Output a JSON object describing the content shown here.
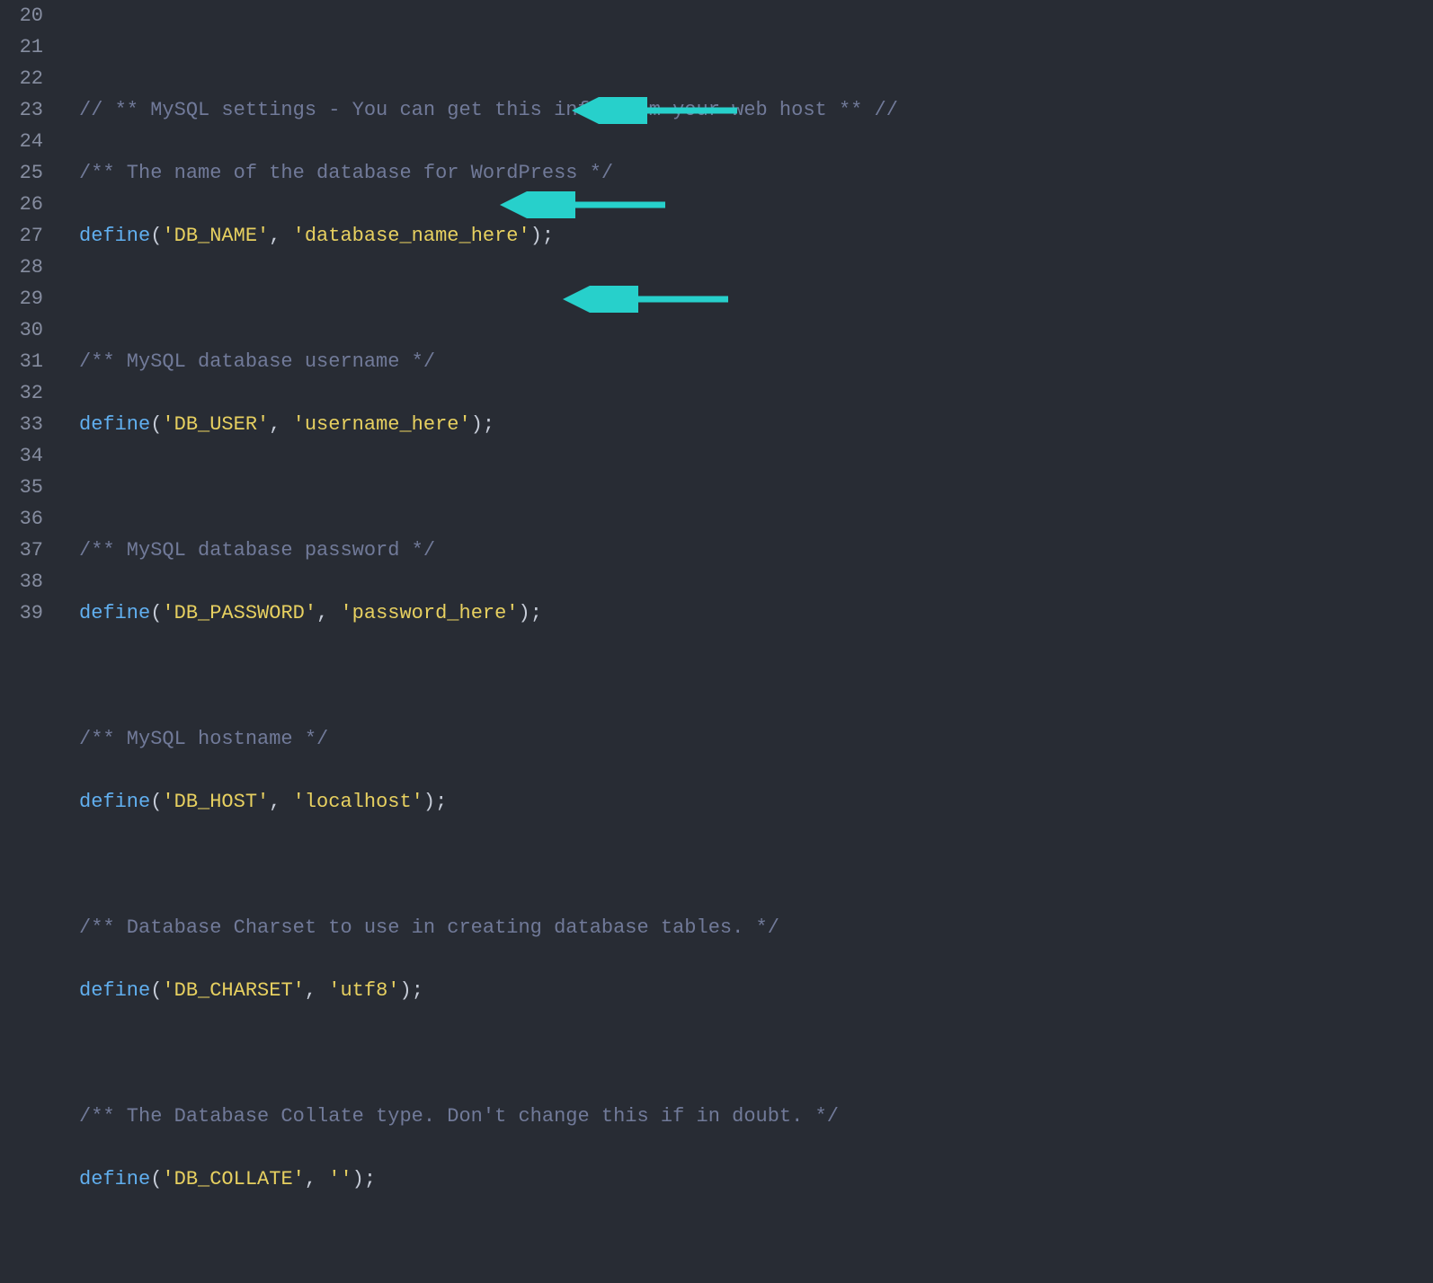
{
  "gutter": {
    "start": 20,
    "end": 39
  },
  "lines": {
    "l20": "",
    "l21_comment": "// ** MySQL settings - You can get this info from your web host ** //",
    "l22_comment": "/** The name of the database for WordPress */",
    "l23_kw": "define",
    "l23_s1": "'DB_NAME'",
    "l23_s2": "'database_name_here'",
    "l24": "",
    "l25_comment": "/** MySQL database username */",
    "l26_kw": "define",
    "l26_s1": "'DB_USER'",
    "l26_s2": "'username_here'",
    "l27": "",
    "l28_comment": "/** MySQL database password */",
    "l29_kw": "define",
    "l29_s1": "'DB_PASSWORD'",
    "l29_s2": "'password_here'",
    "l30": "",
    "l31_comment": "/** MySQL hostname */",
    "l32_kw": "define",
    "l32_s1": "'DB_HOST'",
    "l32_s2": "'localhost'",
    "l33": "",
    "l34_comment": "/** Database Charset to use in creating database tables. */",
    "l35_kw": "define",
    "l35_s1": "'DB_CHARSET'",
    "l35_s2": "'utf8'",
    "l36": "",
    "l37_comment": "/** The Database Collate type. Don't change this if in doubt. */",
    "l38_kw": "define",
    "l38_s1": "'DB_COLLATE'",
    "l38_s2": "''",
    "l39": ""
  },
  "punct": {
    "open": "(",
    "comma": ", ",
    "close": ")",
    "semi": ";"
  },
  "arrows": {
    "color": "#27d0cb"
  }
}
